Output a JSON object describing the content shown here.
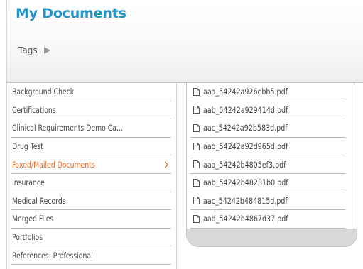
{
  "header": {
    "title": "My Documents",
    "tags_label": "Tags"
  },
  "categories": [
    {
      "label": "Background Check",
      "selected": false
    },
    {
      "label": "Certifications",
      "selected": false
    },
    {
      "label": "Clinical Requirements Demo Ca...",
      "selected": false
    },
    {
      "label": "Drug Test",
      "selected": false
    },
    {
      "label": "Faxed/Mailed Documents",
      "selected": true
    },
    {
      "label": "Insurance",
      "selected": false
    },
    {
      "label": "Medical Records",
      "selected": false
    },
    {
      "label": "Merged Files",
      "selected": false
    },
    {
      "label": "Portfolios",
      "selected": false
    },
    {
      "label": "References: Professional",
      "selected": false
    }
  ],
  "files": [
    {
      "name": "aaa_54242a926ebb5.pdf",
      "icon": "document-icon"
    },
    {
      "name": "aab_54242a929414d.pdf",
      "icon": "document-icon"
    },
    {
      "name": "aac_54242a92b583d.pdf",
      "icon": "document-icon"
    },
    {
      "name": "aad_54242a92d965d.pdf",
      "icon": "document-icon"
    },
    {
      "name": "aaa_54242b4805ef3.pdf",
      "icon": "document-icon"
    },
    {
      "name": "aab_54242b48281b0.pdf",
      "icon": "document-icon"
    },
    {
      "name": "aac_54242b484815d.pdf",
      "icon": "document-icon"
    },
    {
      "name": "aad_54242b4867d37.pdf",
      "icon": "document-icon"
    }
  ],
  "colors": {
    "title": "#2593c6",
    "selected_item": "#e46a2a",
    "text": "#454545",
    "panel_bottom": "#d9d9d9"
  }
}
